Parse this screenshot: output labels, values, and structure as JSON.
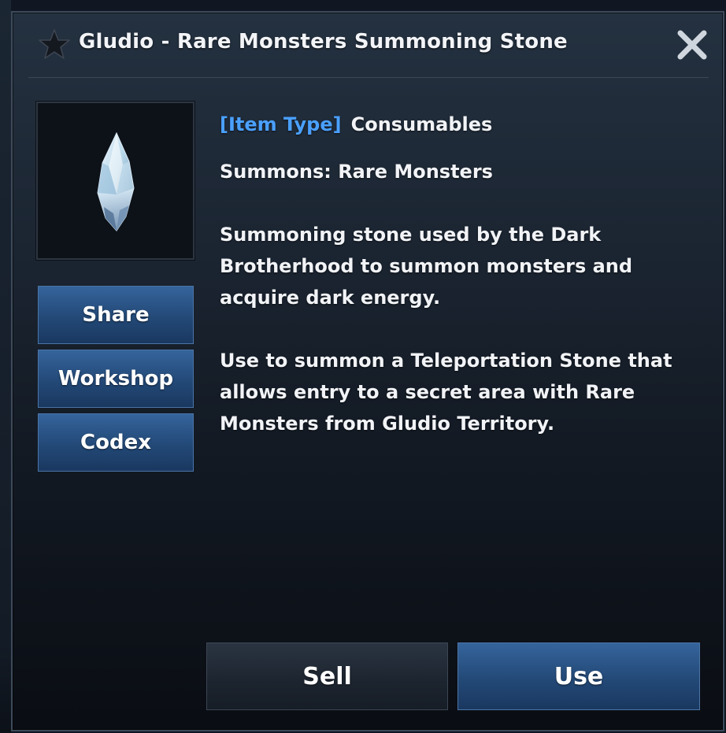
{
  "dialog": {
    "title": "Gludio - Rare Monsters Summoning Stone",
    "icons": {
      "title": "star-icon",
      "close": "close-icon",
      "item": "crystal-stone-icon"
    }
  },
  "item": {
    "type_label": "[Item Type]",
    "type_value": "Consumables",
    "summons": "Summons: Rare Monsters",
    "description": "Summoning stone used by the Dark Brotherhood to summon monsters and acquire dark energy.",
    "usage": "Use to summon a Teleportation Stone that allows entry to a secret area with Rare Monsters from Gludio Territory."
  },
  "side_buttons": {
    "share": "Share",
    "workshop": "Workshop",
    "codex": "Codex"
  },
  "footer": {
    "sell": "Sell",
    "use": "Use"
  },
  "colors": {
    "accent_blue": "#4aa0ff",
    "button_blue": "#234977",
    "button_dark": "#1c242f",
    "panel_border": "#3c4a5a"
  }
}
